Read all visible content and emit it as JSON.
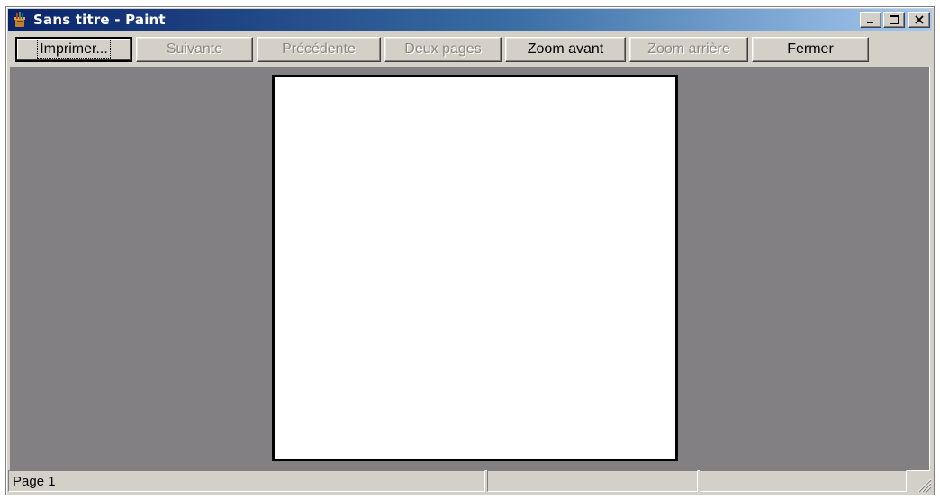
{
  "window": {
    "title": "Sans titre - Paint",
    "app_icon": "paint-app-icon"
  },
  "toolbar": {
    "buttons": [
      {
        "label": "Imprimer...",
        "enabled": true,
        "default": true
      },
      {
        "label": "Suivante",
        "enabled": false
      },
      {
        "label": "Précédente",
        "enabled": false
      },
      {
        "label": "Deux pages",
        "enabled": false
      },
      {
        "label": "Zoom avant",
        "enabled": true
      },
      {
        "label": "Zoom arrière",
        "enabled": false
      },
      {
        "label": "Fermer",
        "enabled": true
      }
    ]
  },
  "statusbar": {
    "page_label": "Page 1",
    "pane2": "",
    "pane3": ""
  },
  "colors": {
    "titlebar_start": "#0a246a",
    "titlebar_end": "#a6caf0",
    "face": "#d4d0c8",
    "preview_bg": "#828083",
    "disabled_text": "#8a8780"
  }
}
